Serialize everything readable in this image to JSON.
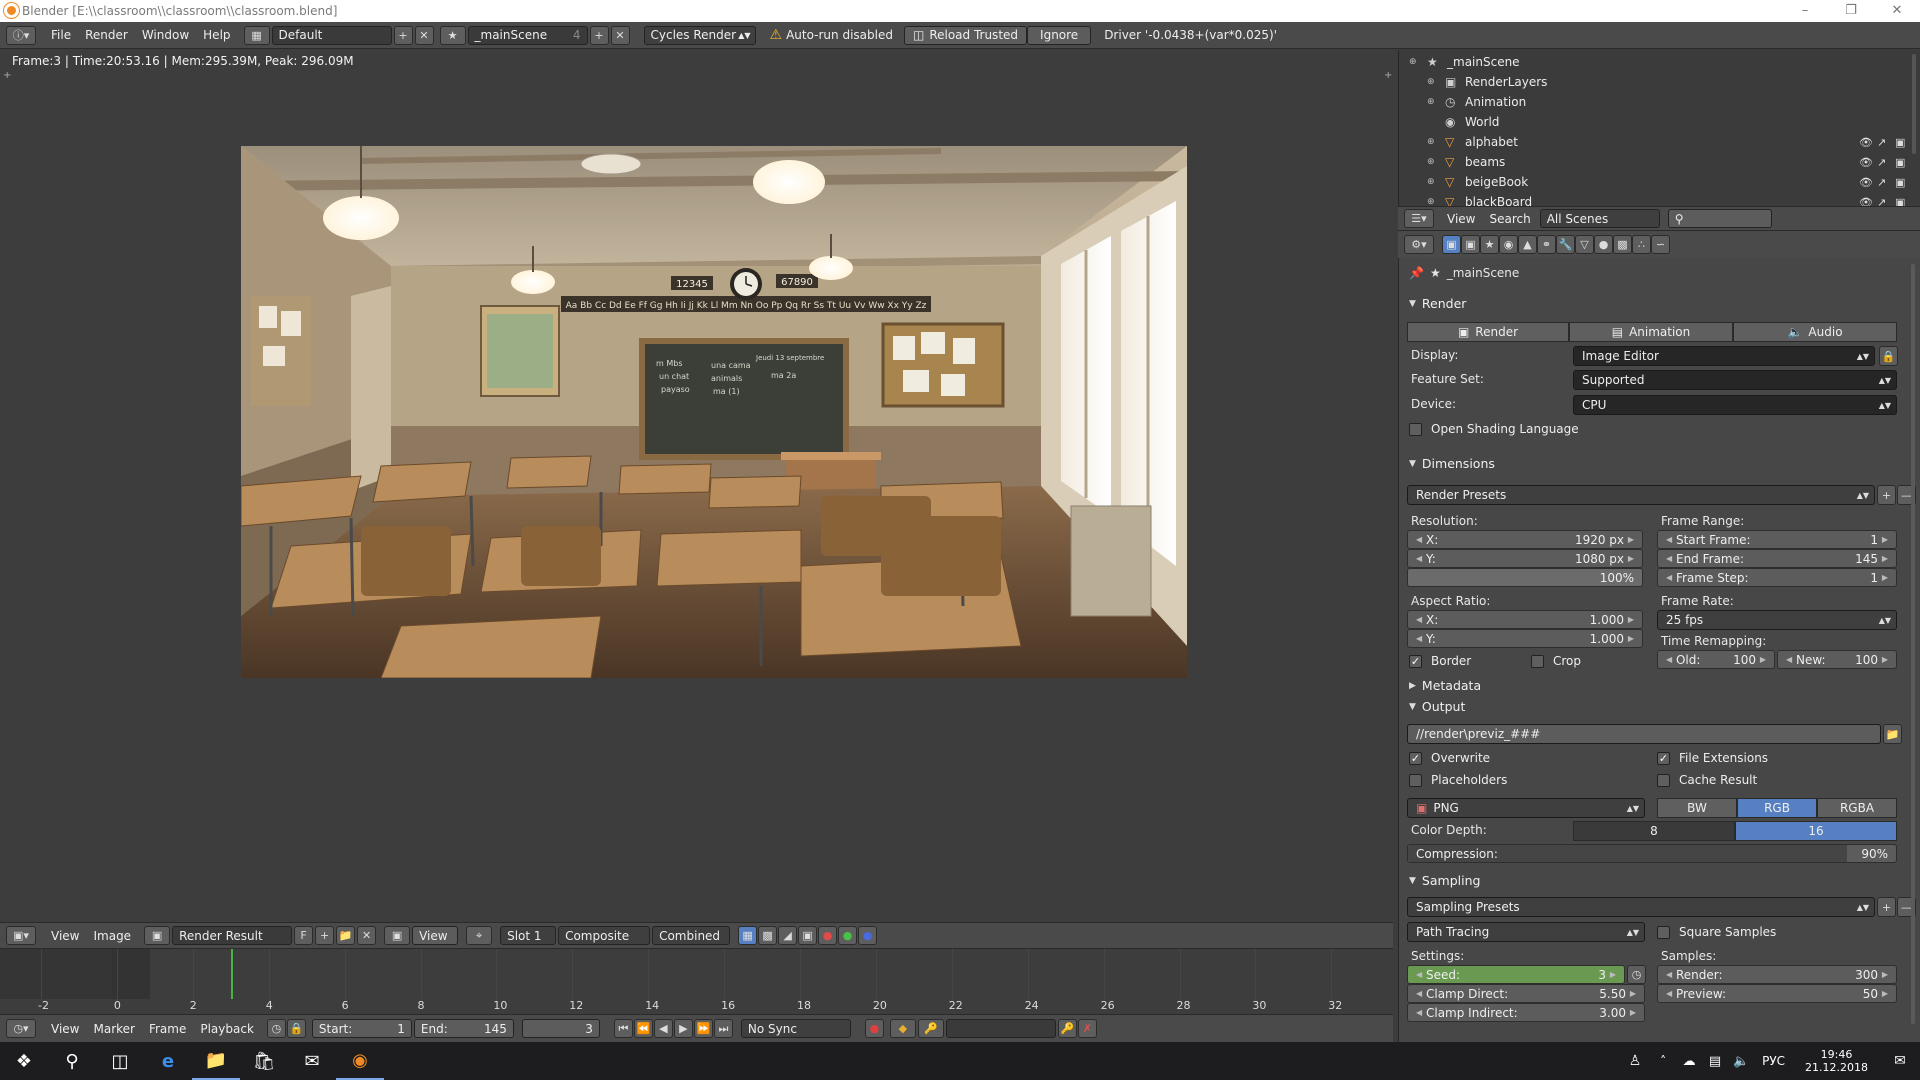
{
  "window": {
    "title": "Blender [E:\\\\classroom\\\\classroom\\\\classroom.blend]"
  },
  "topbar": {
    "menus": [
      "File",
      "Render",
      "Window",
      "Help"
    ],
    "layout": "Default",
    "scene": "_mainScene",
    "scene_users": "4",
    "engine": "Cycles Render",
    "warning": "Auto-run disabled",
    "reload": "Reload Trusted",
    "ignore": "Ignore",
    "driver": "Driver '-0.0438+(var*0.025)'"
  },
  "viewport": {
    "info": "Frame:3 | Time:20:53.16 | Mem:295.39M, Peak: 296.09M"
  },
  "render_scene": {
    "numbers_left": "12345",
    "numbers_right": "67890",
    "alphabet": "Aa Bb Cc Dd Ee Ff Gg Hh Ii Jj Kk Ll Mm Nn Oo Pp Qq Rr Ss Tt Uu Vv Ww Xx Yy Zz",
    "chalk": [
      "m Mbs",
      "un chat",
      "payaso",
      "una cama",
      "animals",
      "ma (1)",
      "Jeudi 13 septembre",
      "ma 2a"
    ]
  },
  "image_editor_header": {
    "menus": [
      "View",
      "Image"
    ],
    "image_name": "Render Result",
    "fake_user": "F",
    "view": "View",
    "slot": "Slot 1",
    "composite": "Composite",
    "pass": "Combined"
  },
  "timeline": {
    "ticks": [
      "-2",
      "0",
      "2",
      "4",
      "6",
      "8",
      "10",
      "12",
      "14",
      "16",
      "18",
      "20",
      "22",
      "24",
      "26",
      "28",
      "30",
      "32"
    ],
    "current_frame": 3
  },
  "timeline_header": {
    "menus": [
      "View",
      "Marker",
      "Frame",
      "Playback"
    ],
    "start_label": "Start:",
    "start_value": "1",
    "end_label": "End:",
    "end_value": "145",
    "current": "3",
    "sync": "No Sync"
  },
  "outliner": {
    "items": [
      {
        "name": "_mainScene",
        "indent": 0
      },
      {
        "name": "RenderLayers",
        "indent": 1
      },
      {
        "name": "Animation",
        "indent": 1
      },
      {
        "name": "World",
        "indent": 1
      },
      {
        "name": "alphabet",
        "indent": 1
      },
      {
        "name": "beams",
        "indent": 1
      },
      {
        "name": "beigeBook",
        "indent": 1
      },
      {
        "name": "blackBoard",
        "indent": 1
      }
    ],
    "header": {
      "view": "View",
      "search": "Search",
      "filter": "All Scenes"
    }
  },
  "properties": {
    "scene": "_mainScene",
    "render": {
      "title": "Render",
      "tabs": [
        "Render",
        "Animation",
        "Audio"
      ],
      "display_label": "Display:",
      "display_value": "Image Editor",
      "feature_label": "Feature Set:",
      "feature_value": "Supported",
      "device_label": "Device:",
      "device_value": "CPU",
      "osl": "Open Shading Language"
    },
    "dimensions": {
      "title": "Dimensions",
      "presets": "Render Presets",
      "resolution_label": "Resolution:",
      "res_x_label": "X:",
      "res_x": "1920 px",
      "res_y_label": "Y:",
      "res_y": "1080 px",
      "res_pct": "100%",
      "aspect_label": "Aspect Ratio:",
      "asp_x_label": "X:",
      "asp_x": "1.000",
      "asp_y_label": "Y:",
      "asp_y": "1.000",
      "border": "Border",
      "crop": "Crop",
      "frame_range_label": "Frame Range:",
      "start_label": "Start Frame:",
      "start": "1",
      "end_label": "End Frame:",
      "end": "145",
      "step_label": "Frame Step:",
      "step": "1",
      "frame_rate_label": "Frame Rate:",
      "fps": "25 fps",
      "remap_label": "Time Remapping:",
      "old_label": "Old:",
      "old": "100",
      "new_label": "New:",
      "new": "100"
    },
    "metadata": {
      "title": "Metadata"
    },
    "output": {
      "title": "Output",
      "path": "//render\\previz_###",
      "overwrite": "Overwrite",
      "file_ext": "File Extensions",
      "placeholders": "Placeholders",
      "cache": "Cache Result",
      "format": "PNG",
      "bw": "BW",
      "rgb": "RGB",
      "rgba": "RGBA",
      "depth_label": "Color Depth:",
      "depth_8": "8",
      "depth_16": "16",
      "compression_label": "Compression:",
      "compression": "90%"
    },
    "sampling": {
      "title": "Sampling",
      "presets": "Sampling Presets",
      "method": "Path Tracing",
      "square": "Square Samples",
      "settings_label": "Settings:",
      "seed_label": "Seed:",
      "seed": "3",
      "clamp_direct_label": "Clamp Direct:",
      "clamp_direct": "5.50",
      "clamp_indirect_label": "Clamp Indirect:",
      "clamp_indirect": "3.00",
      "samples_label": "Samples:",
      "render_label": "Render:",
      "render": "300",
      "preview_label": "Preview:",
      "preview": "50"
    }
  },
  "taskbar": {
    "lang": "РУС",
    "time": "19:46",
    "date": "21.12.2018"
  },
  "colors": {
    "accent_blue": "#5680c2",
    "seed_green": "#6a9a52",
    "frame_line": "#44b444",
    "blender_orange": "#f08a24"
  }
}
